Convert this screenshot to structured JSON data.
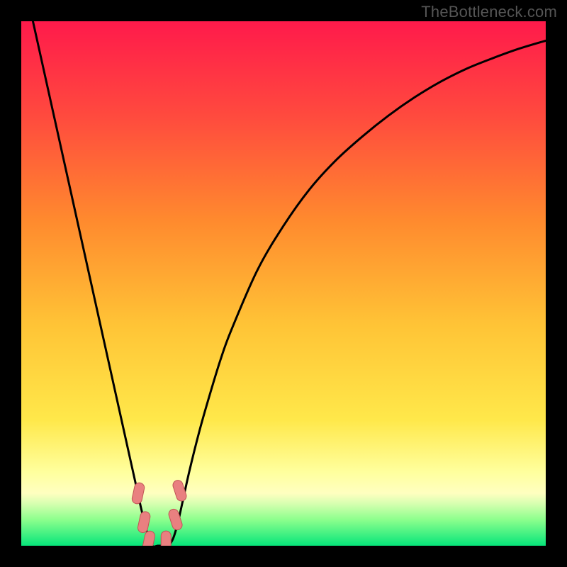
{
  "watermark": {
    "text": "TheBottleneck.com"
  },
  "colors": {
    "gradient_top": "#ff1a4b",
    "gradient_mid1": "#ff7a2e",
    "gradient_mid2": "#ffd936",
    "gradient_band": "#ffff9e",
    "gradient_green1": "#7aff7a",
    "gradient_green2": "#00e676",
    "curve": "#000000",
    "marker_fill": "#e98080",
    "marker_stroke": "#c05555",
    "frame_bg": "#000000"
  },
  "chart_data": {
    "type": "line",
    "title": "",
    "xlabel": "",
    "ylabel": "",
    "xlim": [
      0,
      100
    ],
    "ylim": [
      0,
      100
    ],
    "x": [
      0,
      2,
      4,
      6,
      8,
      10,
      12,
      14,
      16,
      18,
      20,
      22,
      23,
      24,
      25,
      26,
      27,
      28,
      29,
      30,
      32,
      34,
      36,
      38,
      40,
      45,
      50,
      55,
      60,
      65,
      70,
      75,
      80,
      85,
      90,
      95,
      100
    ],
    "y": [
      110,
      101,
      92,
      83,
      74,
      65,
      56,
      47,
      38,
      29,
      20,
      11,
      6.5,
      2.5,
      0,
      0,
      0,
      0,
      1.5,
      5,
      14,
      22,
      29,
      35.5,
      41,
      52.5,
      61,
      68,
      73.5,
      78,
      82,
      85.5,
      88.5,
      91,
      93,
      94.8,
      96.3
    ],
    "markers": [
      {
        "x": 22.3,
        "y": 10.0
      },
      {
        "x": 23.4,
        "y": 4.5
      },
      {
        "x": 24.3,
        "y": 0.8
      },
      {
        "x": 27.6,
        "y": 0.8
      },
      {
        "x": 29.4,
        "y": 5.0
      },
      {
        "x": 30.2,
        "y": 10.5
      }
    ]
  }
}
